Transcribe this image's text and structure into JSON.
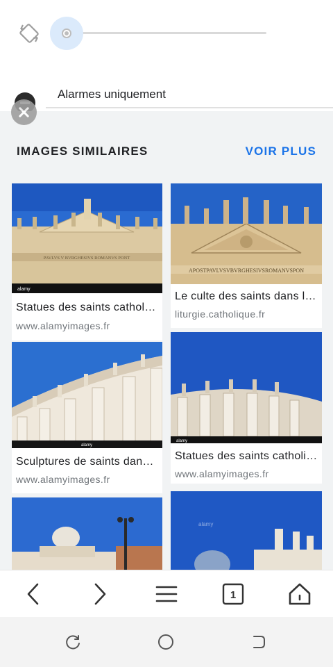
{
  "quick_settings": {
    "brightness_level": 0.0,
    "dnd_label": "Alarmes uniquement"
  },
  "section": {
    "title": "IMAGES SIMILAIRES",
    "see_more": "VOIR PLUS"
  },
  "results": [
    {
      "title": "Statues des saints catholiques",
      "source": "www.alamyimages.fr",
      "watermark": "alamy",
      "inscription": "PAVLVS V BVRGHESIVS ROMANVS PONT"
    },
    {
      "title": "Le culte des saints dans l'Église",
      "source": "liturgie.catholique.fr",
      "inscription": "APOSTPAVLVSVBVRGHESIVSROMANVSPON"
    },
    {
      "title": "Sculptures de saints dans la colonnade",
      "source": "www.alamyimages.fr",
      "watermark": "alamy"
    },
    {
      "title": "Statues des saints catholiques",
      "source": "www.alamyimages.fr",
      "watermark": "alamy"
    },
    {
      "title": "",
      "source": ""
    },
    {
      "title": "",
      "source": "",
      "watermark": "alamy"
    }
  ],
  "browser_nav": {
    "tab_count": "1"
  },
  "colors": {
    "accent": "#1a73e8",
    "sky": "#1f5fc4",
    "stone": "#d9c7a3"
  }
}
